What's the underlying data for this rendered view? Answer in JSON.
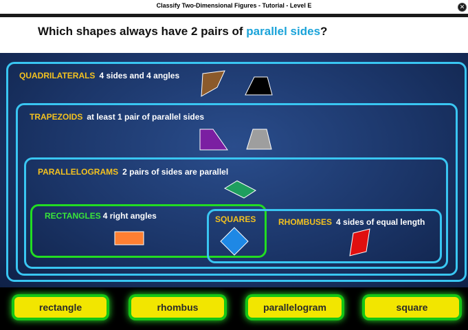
{
  "window": {
    "title": "Classify Two-Dimensional Figures - Tutorial - Level E",
    "close_glyph": "✕"
  },
  "question": {
    "prefix": "Which shapes always have 2 pairs of ",
    "highlight": "parallel sides",
    "suffix": "?"
  },
  "categories": {
    "quadrilaterals": {
      "heading": "QUADRILATERALS",
      "description": "4 sides and 4 angles"
    },
    "trapezoids": {
      "heading": "TRAPEZOIDS",
      "description": "at least 1 pair of parallel sides"
    },
    "parallelograms": {
      "heading": "PARALLELOGRAMS",
      "description": "2 pairs of sides are parallel"
    },
    "rectangles": {
      "heading": "RECTANGLES",
      "description": "4 right angles"
    },
    "squares": {
      "heading": "SQUARES"
    },
    "rhombuses": {
      "heading": "RHOMBUSES",
      "description": "4 sides of equal length"
    }
  },
  "answer_buttons": [
    "rectangle",
    "rhombus",
    "parallelogram",
    "square"
  ],
  "colors": {
    "box_border": "#39c6f2",
    "rect_box_border": "#22dd22",
    "heading": "#f4c21f",
    "rect_heading": "#39e639",
    "highlight": "#1aa3d9",
    "button_fill": "#f2e600",
    "button_glow": "#15c515",
    "shape_brown": "#8b5a2b",
    "shape_black": "#000000",
    "shape_purple": "#7b1fa2",
    "shape_gray": "#9e9e9e",
    "shape_green": "#1e9e5e",
    "shape_orange": "#ff7f32",
    "shape_blue": "#1e88e5",
    "shape_red": "#e01010"
  }
}
